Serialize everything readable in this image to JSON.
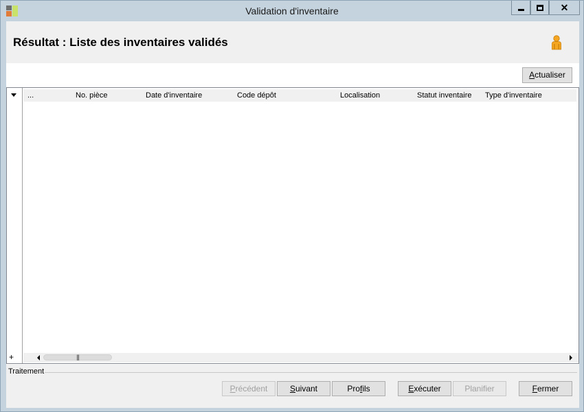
{
  "window": {
    "title": "Validation d'inventaire"
  },
  "header": {
    "title": "Résultat : Liste des inventaires validés"
  },
  "toolbar": {
    "refresh_accel": "A",
    "refresh_rest": "ctualiser"
  },
  "grid": {
    "columns": [
      "...",
      "No. pièce",
      "Date d'inventaire",
      "Code dépôt",
      "Localisation",
      "Statut inventaire",
      "Type d'inventaire"
    ],
    "add_row_symbol": "+",
    "scroll_grip": "|||"
  },
  "footer": {
    "section_label": "Traitement",
    "buttons": {
      "previous": {
        "accel": "P",
        "rest": "récédent"
      },
      "next": {
        "accel": "S",
        "rest": "uivant"
      },
      "profiles": {
        "pre": "Pro",
        "accel": "f",
        "rest": "ils"
      },
      "execute": {
        "accel": "E",
        "rest": "xécuter"
      },
      "schedule": {
        "label": "Planifier"
      },
      "close": {
        "accel": "F",
        "rest": "ermer"
      }
    }
  },
  "icons": {
    "app": "app-icon",
    "user": "user-icon",
    "filter": "chevron-down-icon"
  },
  "colors": {
    "chrome": "#c5d3de",
    "panel": "#f0f0f0",
    "user_icon": "#f5a623"
  }
}
